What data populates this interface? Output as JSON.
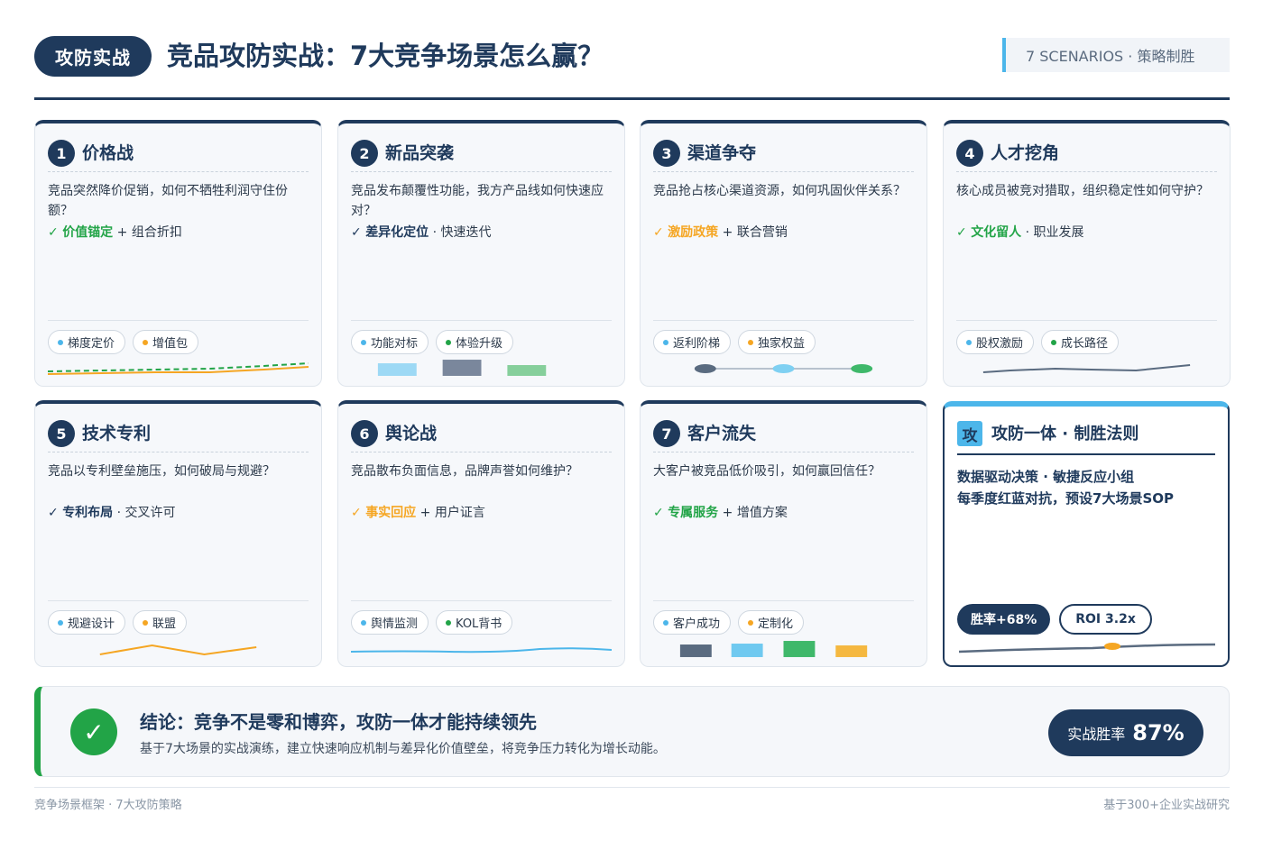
{
  "header": {
    "badge": "攻防实战",
    "title": "竞品攻防实战：7大竞争场景怎么赢？",
    "tag": "7 SCENARIOS · 策略制胜"
  },
  "colors": {
    "navy": "#1f3a5c",
    "accent_blue": "#4cb6ea",
    "green": "#22a447",
    "orange": "#f5a623"
  },
  "cards": [
    {
      "num": "1",
      "title": "价格战",
      "desc": "竞品突然降价促销，如何不牺牲利润守住份额？",
      "check": "✓",
      "check_color": "green",
      "key": "价值锚定",
      "sep": "+",
      "rest": "组合折扣",
      "pills": [
        {
          "label": "梯度定价",
          "color": "#4cb6ea"
        },
        {
          "label": "增值包",
          "color": "#f5a623"
        }
      ],
      "viz": "lines"
    },
    {
      "num": "2",
      "title": "新品突袭",
      "desc": "竞品发布颠覆性功能，我方产品线如何快速应对？",
      "check": "✓",
      "check_color": "navy",
      "key": "差异化定位",
      "sep": "·",
      "rest": "快速迭代",
      "pills": [
        {
          "label": "功能对标",
          "color": "#4cb6ea"
        },
        {
          "label": "体验升级",
          "color": "#22a447"
        }
      ],
      "viz": "blocks3"
    },
    {
      "num": "3",
      "title": "渠道争夺",
      "desc": "竞品抢占核心渠道资源，如何巩固伙伴关系？",
      "check": "✓",
      "check_color": "orange",
      "key": "激励政策",
      "sep": "+",
      "rest": "联合营销",
      "pills": [
        {
          "label": "返利阶梯",
          "color": "#4cb6ea"
        },
        {
          "label": "独家权益",
          "color": "#f5a623"
        }
      ],
      "viz": "nodes"
    },
    {
      "num": "4",
      "title": "人才挖角",
      "desc": "核心成员被竞对猎取，组织稳定性如何守护？",
      "check": "✓",
      "check_color": "green",
      "key": "文化留人",
      "sep": "·",
      "rest": "职业发展",
      "pills": [
        {
          "label": "股权激励",
          "color": "#4cb6ea"
        },
        {
          "label": "成长路径",
          "color": "#22a447"
        }
      ],
      "viz": "flat"
    },
    {
      "num": "5",
      "title": "技术专利",
      "desc": "竞品以专利壁垒施压，如何破局与规避？",
      "check": "✓",
      "check_color": "navy",
      "key": "专利布局",
      "sep": "·",
      "rest": "交叉许可",
      "pills": [
        {
          "label": "规避设计",
          "color": "#4cb6ea"
        },
        {
          "label": "联盟",
          "color": "#f5a623"
        }
      ],
      "viz": "zigzag"
    },
    {
      "num": "6",
      "title": "舆论战",
      "desc": "竞品散布负面信息，品牌声誉如何维护？",
      "check": "✓",
      "check_color": "orange",
      "key": "事实回应",
      "sep": "+",
      "rest": "用户证言",
      "pills": [
        {
          "label": "舆情监测",
          "color": "#4cb6ea"
        },
        {
          "label": "KOL背书",
          "color": "#22a447"
        }
      ],
      "viz": "wave"
    },
    {
      "num": "7",
      "title": "客户流失",
      "desc": "大客户被竞品低价吸引，如何赢回信任？",
      "check": "✓",
      "check_color": "green",
      "key": "专属服务",
      "sep": "+",
      "rest": "增值方案",
      "pills": [
        {
          "label": "客户成功",
          "color": "#4cb6ea"
        },
        {
          "label": "定制化",
          "color": "#f5a623"
        }
      ],
      "viz": "blocks4"
    }
  ],
  "final_card": {
    "icon": "攻",
    "title": "攻防一体 · 制胜法则",
    "line1": "数据驱动决策 · 敏捷反应小组",
    "line2": "每季度红蓝对抗，预设7大场景SOP",
    "pill_dark": "胜率+68%",
    "pill_light": "ROI 3.2x"
  },
  "conclusion": {
    "icon": "✓",
    "title": "结论：竞争不是零和博弈，攻防一体才能持续领先",
    "subtitle": "基于7大场景的实战演练，建立快速响应机制与差异化价值壁垒，将竞争压力转化为增长动能。",
    "rate_label": "实战胜率",
    "rate_value": "87%"
  },
  "footer": {
    "left": "竞争场景框架 · 7大攻防策略",
    "right": "基于300+企业实战研究"
  }
}
